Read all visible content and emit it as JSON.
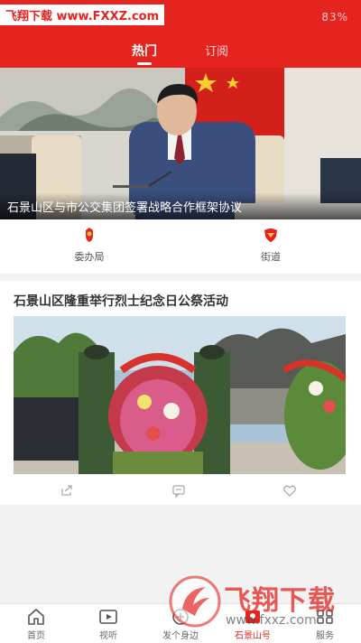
{
  "watermark_top": "飞翔下载 www.FXXZ.com",
  "status_bar": {
    "text": "83%"
  },
  "tabs": [
    {
      "label": "热门",
      "active": true
    },
    {
      "label": "订阅",
      "active": false
    }
  ],
  "banner": {
    "caption": "石景山区与市公交集团签署战略合作框架协议"
  },
  "shortcuts": [
    {
      "label": "委办局",
      "icon": "badge-icon"
    },
    {
      "label": "街道",
      "icon": "emblem-icon"
    }
  ],
  "article": {
    "title": "石景山区隆重举行烈士纪念日公祭活动",
    "actions": [
      "share-icon",
      "comment-icon",
      "like-icon"
    ]
  },
  "bottom_nav": [
    {
      "label": "首页",
      "icon": "home-icon",
      "active": false
    },
    {
      "label": "视听",
      "icon": "video-icon",
      "active": false
    },
    {
      "label": "发个身边",
      "icon": "post-icon",
      "active": false
    },
    {
      "label": "石景山号",
      "icon": "account-icon",
      "active": true
    },
    {
      "label": "服务",
      "icon": "service-icon",
      "active": false
    }
  ],
  "watermark_bottom": {
    "brand": "飞翔下载",
    "url": "www.fxxz.com"
  },
  "colors": {
    "brand_red": "#e5231f"
  }
}
